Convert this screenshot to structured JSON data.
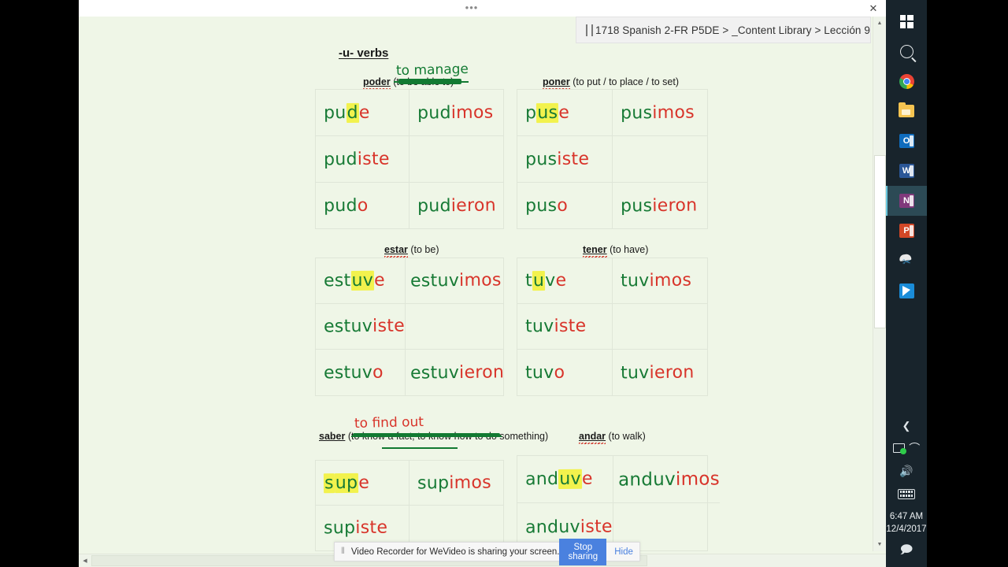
{
  "window": {
    "ellipsis": "•••",
    "close_label": "✕"
  },
  "breadcrumb": {
    "icon": "notebook-icon",
    "text": "1718 Spanish 2-FR P5DE  >  _Content Library  >  Lección 9",
    "caret": "▼",
    "expand": "⤢"
  },
  "notes": {
    "section_title": "-u- verbs",
    "verbs": [
      {
        "id": "poder",
        "infinitive": "poder",
        "translation": "(to be able to)",
        "translation_struck": true,
        "annotation": "to manage",
        "annotation_color": "green",
        "forms": [
          {
            "stem": "pu",
            "highlight": "d",
            "ending": "e",
            "text": "pude"
          },
          {
            "stem": "pud",
            "ending": "imos",
            "text": "pudimos"
          },
          {
            "stem": "pud",
            "ending": "iste",
            "text": "pudiste"
          },
          {
            "stem": "",
            "ending": "",
            "text": ""
          },
          {
            "stem": "pud",
            "ending": "o",
            "text": "pudo"
          },
          {
            "stem": "pud",
            "ending": "ieron",
            "text": "pudieron"
          }
        ]
      },
      {
        "id": "poner",
        "infinitive": "poner",
        "translation": "(to put / to place / to set)",
        "translation_struck": false,
        "annotation": "",
        "forms": [
          {
            "stem": "p",
            "highlight": "us",
            "ending": "e",
            "text": "puse"
          },
          {
            "stem": "pus",
            "ending": "imos",
            "text": "pusimos"
          },
          {
            "stem": "pus",
            "ending": "iste",
            "text": "pusiste"
          },
          {
            "stem": "",
            "ending": "",
            "text": ""
          },
          {
            "stem": "pus",
            "ending": "o",
            "text": "puso"
          },
          {
            "stem": "pus",
            "ending": "ieron",
            "text": "pusieron"
          }
        ]
      },
      {
        "id": "estar",
        "infinitive": "estar",
        "translation": "(to be)",
        "translation_struck": false,
        "annotation": "",
        "forms": [
          {
            "stem": "est",
            "highlight": "uv",
            "ending": "e",
            "text": "estuve"
          },
          {
            "stem": "estuv",
            "ending": "imos",
            "text": "estuvimos"
          },
          {
            "stem": "estuv",
            "ending": "iste",
            "text": "estuviste"
          },
          {
            "stem": "",
            "ending": "",
            "text": ""
          },
          {
            "stem": "estuv",
            "ending": "o",
            "text": "estuvo"
          },
          {
            "stem": "estuv",
            "ending": "ieron",
            "text": "estuvieron"
          }
        ]
      },
      {
        "id": "tener",
        "infinitive": "tener",
        "translation": "(to have)",
        "translation_struck": false,
        "annotation": "",
        "forms": [
          {
            "stem": "t",
            "highlight": "u",
            "ending": "ve",
            "text": "tuve"
          },
          {
            "stem": "tuv",
            "ending": "imos",
            "text": "tuvimos"
          },
          {
            "stem": "tuv",
            "ending": "iste",
            "text": "tuviste"
          },
          {
            "stem": "",
            "ending": "",
            "text": ""
          },
          {
            "stem": "tuv",
            "ending": "o",
            "text": "tuvo"
          },
          {
            "stem": "tuv",
            "ending": "ieron",
            "text": "tuvieron"
          }
        ]
      },
      {
        "id": "saber",
        "infinitive": "saber",
        "translation": "(to know a fact, to know how to do something)",
        "translation_struck": true,
        "annotation": "to find out",
        "annotation_color": "red",
        "forms": [
          {
            "stem": "s",
            "highlight": "up",
            "ending": "e",
            "text": "supe"
          },
          {
            "stem": "sup",
            "ending": "imos",
            "text": "supimos"
          },
          {
            "stem": "sup",
            "ending": "iste",
            "text": "supiste"
          },
          {
            "stem": "",
            "ending": "",
            "text": ""
          }
        ]
      },
      {
        "id": "andar",
        "infinitive": "andar",
        "translation": "(to walk)",
        "translation_struck": false,
        "annotation": "",
        "forms": [
          {
            "stem": "and",
            "highlight": "uv",
            "ending": "e",
            "text": "anduve"
          },
          {
            "stem": "anduv",
            "ending": "imos",
            "text": "anduvimos"
          },
          {
            "stem": "anduv",
            "ending": "iste",
            "text": "anduviste"
          },
          {
            "stem": "",
            "ending": "",
            "text": ""
          }
        ]
      }
    ],
    "colors": {
      "stem": "#177a35",
      "ending": "#d8342a",
      "highlight": "#f2f24d",
      "page_bg": "#eff6e7"
    }
  },
  "sharebar": {
    "grip": "⦀",
    "message": "Video Recorder for WeVideo is sharing your screen.",
    "stop_label": "Stop sharing",
    "hide_label": "Hide",
    "accent": "#4a81df"
  },
  "scrollbars": {
    "v_up": "▲",
    "v_down": "▼",
    "h_left": "◀"
  },
  "taskbar": {
    "items": [
      {
        "name": "start-button",
        "label": "Start"
      },
      {
        "name": "search-icon",
        "label": "Search"
      },
      {
        "name": "chrome-icon",
        "label": "Google Chrome"
      },
      {
        "name": "file-explorer-icon",
        "label": "File Explorer"
      },
      {
        "name": "outlook-icon",
        "label": "Outlook",
        "glyph": "O"
      },
      {
        "name": "word-icon",
        "label": "Word",
        "glyph": "W"
      },
      {
        "name": "onenote-icon",
        "label": "OneNote",
        "glyph": "N",
        "active": true
      },
      {
        "name": "powerpoint-icon",
        "label": "PowerPoint",
        "glyph": "P"
      },
      {
        "name": "snipping-tool-icon",
        "label": "Snipping Tool"
      },
      {
        "name": "blue-app-icon",
        "label": "App"
      }
    ],
    "tray": {
      "chevron": "❮",
      "network": "network-icon",
      "wifi": "((",
      "volume": "🔊",
      "keyboard": "keyboard-icon",
      "time": "6:47 AM",
      "date": "12/4/2017",
      "action_center": "action-center-icon"
    }
  }
}
